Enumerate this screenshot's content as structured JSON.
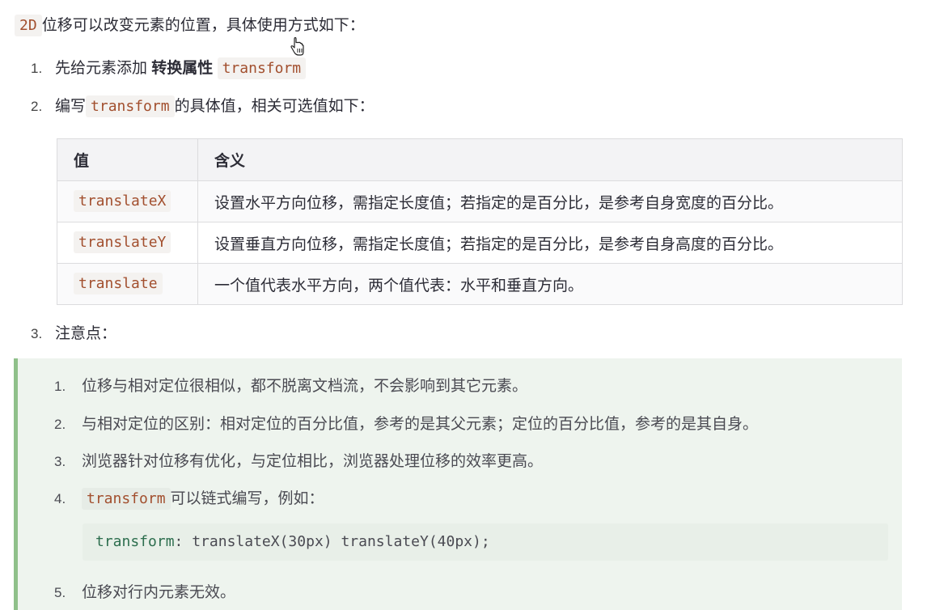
{
  "intro": {
    "code": "2D",
    "text": "位移可以改变元素的位置，具体使用方式如下："
  },
  "steps": [
    {
      "num": "1.",
      "text": "先给元素添加",
      "bold": "转换属性",
      "code": "transform"
    },
    {
      "num": "2.",
      "text_before": "编写",
      "code": "transform",
      "text_after": "的具体值，相关可选值如下："
    },
    {
      "num": "3.",
      "text": "注意点："
    }
  ],
  "table": {
    "headers": [
      "值",
      "含义"
    ],
    "rows": [
      {
        "value": "translateX",
        "meaning": "设置水平方向位移，需指定长度值；若指定的是百分比，是参考自身宽度的百分比。"
      },
      {
        "value": "translateY",
        "meaning": "设置垂直方向位移，需指定长度值；若指定的是百分比，是参考自身高度的百分比。"
      },
      {
        "value": "translate",
        "meaning": "一个值代表水平方向，两个值代表：水平和垂直方向。"
      }
    ]
  },
  "notes": [
    {
      "num": "1.",
      "text": "位移与相对定位很相似，都不脱离文档流，不会影响到其它元素。"
    },
    {
      "num": "2.",
      "text": "与相对定位的区别：相对定位的百分比值，参考的是其父元素；定位的百分比值，参考的是其自身。"
    },
    {
      "num": "3.",
      "text": "浏览器针对位移有优化，与定位相比，浏览器处理位移的效率更高。"
    },
    {
      "num": "4.",
      "code": "transform",
      "text": "可以链式编写，例如："
    },
    {
      "num": "5.",
      "text": "位移对行内元素无效。"
    }
  ],
  "code_example": {
    "keyword": "transform",
    "rest": ": translateX(30px) translateY(40px);"
  },
  "colors": {
    "code_text": "#a24f2e",
    "note_bg": "#eef4ee",
    "note_border": "#8fc08a"
  },
  "icons": {
    "cursor": "hand-pointer-icon"
  }
}
